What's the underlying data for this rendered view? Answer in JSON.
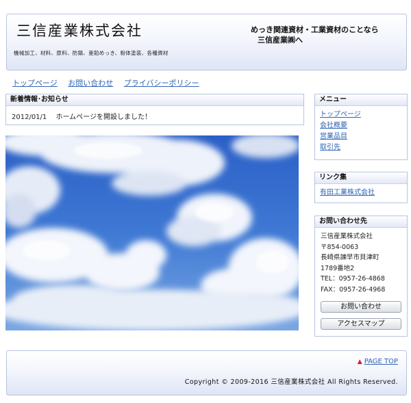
{
  "header": {
    "logo": "三信産業株式会社",
    "tagline_small": "機械加工、材料、原料、防錆、亜鉛めっき、粉体塗装、各種資材",
    "tagline_line1": "めっき関連資材・工業資材のことなら",
    "tagline_line2": "三信産業㈱へ"
  },
  "topnav": {
    "items": [
      "トップページ",
      "お問い合わせ",
      "プライバシーポリシー"
    ]
  },
  "news": {
    "title": "新着情報･お知らせ",
    "date": "2012/01/1",
    "text": "ホームページを開設しました！"
  },
  "sidebar": {
    "menu_title": "メニュー",
    "menu_items": [
      "トップページ",
      "会社概要",
      "営業品目",
      "取引先"
    ],
    "links_title": "リンク集",
    "links_items": [
      "有田工業株式会社"
    ],
    "contact_title": "お問い合わせ先",
    "contact_lines": [
      "三信産業株式会社",
      "〒854-0063",
      "長崎県諫早市貝津町",
      "1789番地2",
      "TEL：0957-26-4868",
      "FAX：0957-26-4968"
    ],
    "btn_inquiry": "お問い合わせ",
    "btn_access": "アクセスマップ"
  },
  "footer": {
    "pagetop": "PAGE TOP",
    "copyright": "Copyright © 2009-2016 三信産業株式会社 All Rights Reserved."
  }
}
